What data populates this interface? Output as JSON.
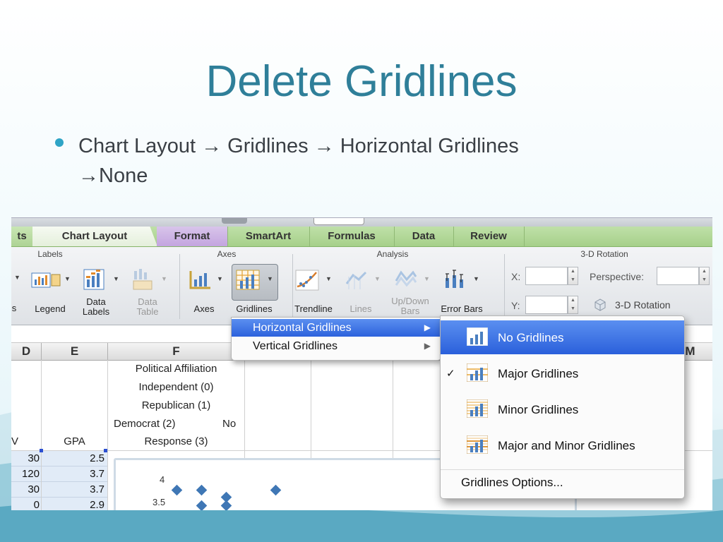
{
  "slide": {
    "title": "Delete Gridlines",
    "bullet_line1": "Chart Layout → Gridlines → Horizontal Gridlines",
    "bullet_line2": "→None"
  },
  "ribbon": {
    "tabs": [
      "ts",
      "Chart Layout",
      "Format",
      "SmartArt",
      "Formulas",
      "Data",
      "Review"
    ],
    "groups": {
      "labels": "Labels",
      "axes": "Axes",
      "analysis": "Analysis",
      "rotation": "3-D Rotation"
    },
    "buttons": {
      "legend": "Legend",
      "data_labels": "Data Labels",
      "data_table": "Data Table",
      "axes": "Axes",
      "gridlines": "Gridlines",
      "trendline": "Trendline",
      "lines": "Lines",
      "updown_bars": "Up/Down Bars",
      "error_bars": "Error Bars",
      "rotation_3d": "3-D Rotation",
      "left_cut": "s"
    },
    "rotation": {
      "x_label": "X:",
      "y_label": "Y:",
      "perspective_label": "Perspective:"
    }
  },
  "sheet": {
    "columns": [
      "D",
      "E",
      "F",
      "M"
    ],
    "header_cells": {
      "f_line1": "Political Affiliation",
      "f_line2": "Independent (0)",
      "f_line3": "Republican (1)",
      "f_line4": "Democrat (2)",
      "f_no": "No",
      "f_line5": "Response (3)",
      "e_header": "GPA",
      "d_header": "V"
    },
    "rows": [
      {
        "d": "30",
        "e": "2.5"
      },
      {
        "d": "120",
        "e": "3.7"
      },
      {
        "d": "30",
        "e": "3.7"
      },
      {
        "d": "0",
        "e": "2.9"
      }
    ]
  },
  "chart": {
    "y_ticks": [
      "4",
      "3.5"
    ]
  },
  "chart_data": {
    "type": "scatter",
    "title": "",
    "x": [
      1,
      2,
      3,
      5,
      2,
      3
    ],
    "y": [
      3.75,
      3.75,
      3.6,
      3.75,
      3.4,
      3.4
    ],
    "ylim": [
      3.5,
      4
    ],
    "y_ticks": [
      "4",
      "3.5"
    ],
    "grid": true
  },
  "menus": {
    "gridlines_menu": [
      "Horizontal Gridlines",
      "Vertical Gridlines"
    ],
    "submenu_arrow": "▶",
    "horizontal_submenu": [
      {
        "label": "No Gridlines",
        "highlighted": true,
        "checked": false
      },
      {
        "label": "Major Gridlines",
        "highlighted": false,
        "checked": true
      },
      {
        "label": "Minor Gridlines",
        "highlighted": false,
        "checked": false
      },
      {
        "label": "Major and Minor Gridlines",
        "highlighted": false,
        "checked": false
      }
    ],
    "check_mark": "✓",
    "options": "Gridlines Options..."
  },
  "colors": {
    "title": "#2f7f99",
    "bullet": "#2fa4c6",
    "tab_green": "#a6d08a",
    "format_tab": "#c3a5df",
    "menu_highlight": "#2c62dc",
    "marker": "#3f77b5"
  }
}
